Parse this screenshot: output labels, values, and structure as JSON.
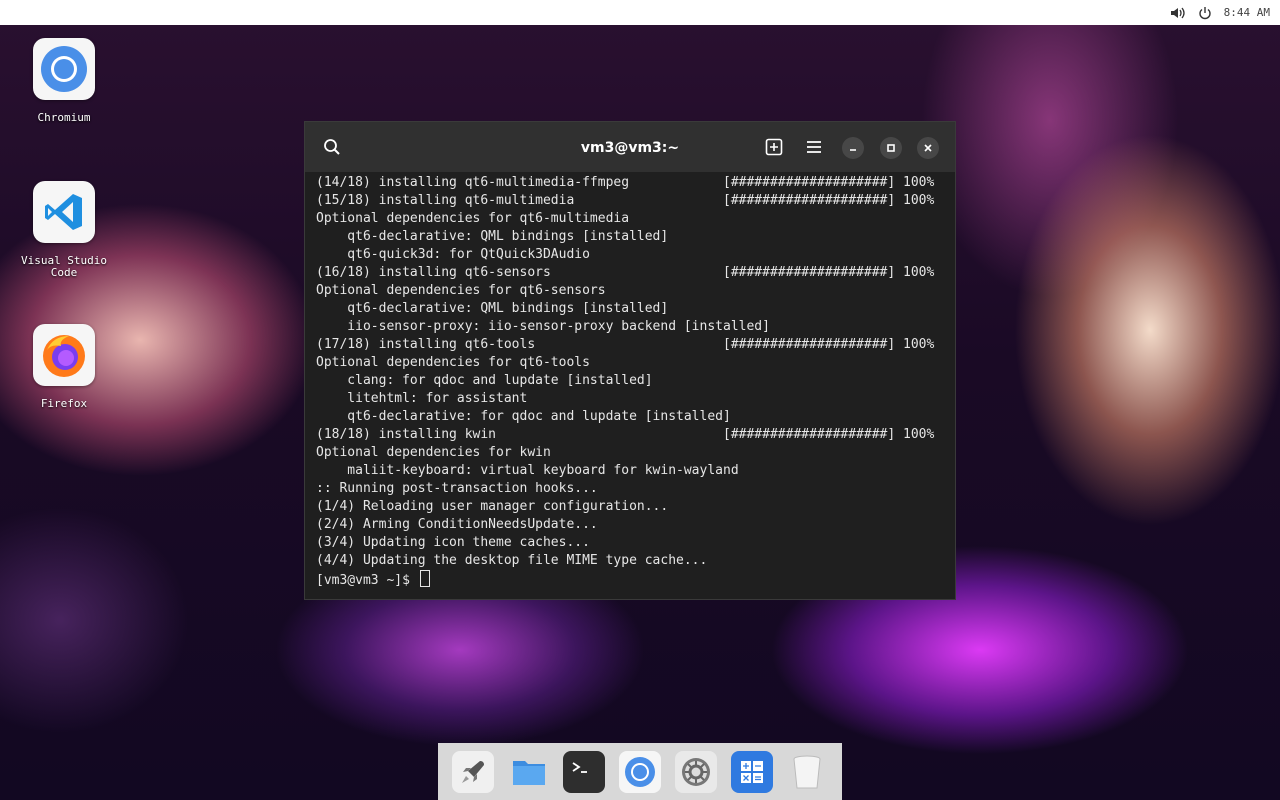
{
  "topbar": {
    "time": "8:44 AM",
    "icons": [
      "volume-icon",
      "power-icon"
    ]
  },
  "desktop": {
    "icons": [
      {
        "label": "Chromium",
        "icon": "chromium-icon"
      },
      {
        "label": "Visual Studio Code",
        "icon": "vscode-icon"
      },
      {
        "label": "Firefox",
        "icon": "firefox-icon"
      }
    ]
  },
  "terminal": {
    "title": "vm3@vm3:~",
    "header_icons": [
      "search-icon",
      "new-tab-icon",
      "menu-icon",
      "minimize-icon",
      "maximize-icon",
      "close-icon"
    ],
    "lines": [
      {
        "text": "(14/18) installing qt6-multimedia-ffmpeg",
        "progress": "[####################] 100%"
      },
      {
        "text": "(15/18) installing qt6-multimedia",
        "progress": "[####################] 100%"
      },
      {
        "text": "Optional dependencies for qt6-multimedia",
        "progress": ""
      },
      {
        "text": "    qt6-declarative: QML bindings [installed]",
        "progress": ""
      },
      {
        "text": "    qt6-quick3d: for QtQuick3DAudio",
        "progress": ""
      },
      {
        "text": "(16/18) installing qt6-sensors",
        "progress": "[####################] 100%"
      },
      {
        "text": "Optional dependencies for qt6-sensors",
        "progress": ""
      },
      {
        "text": "    qt6-declarative: QML bindings [installed]",
        "progress": ""
      },
      {
        "text": "    iio-sensor-proxy: iio-sensor-proxy backend [installed]",
        "progress": ""
      },
      {
        "text": "(17/18) installing qt6-tools",
        "progress": "[####################] 100%"
      },
      {
        "text": "Optional dependencies for qt6-tools",
        "progress": ""
      },
      {
        "text": "    clang: for qdoc and lupdate [installed]",
        "progress": ""
      },
      {
        "text": "    litehtml: for assistant",
        "progress": ""
      },
      {
        "text": "    qt6-declarative: for qdoc and lupdate [installed]",
        "progress": ""
      },
      {
        "text": "(18/18) installing kwin",
        "progress": "[####################] 100%"
      },
      {
        "text": "Optional dependencies for kwin",
        "progress": ""
      },
      {
        "text": "    maliit-keyboard: virtual keyboard for kwin-wayland",
        "progress": ""
      },
      {
        "text": ":: Running post-transaction hooks...",
        "progress": ""
      },
      {
        "text": "(1/4) Reloading user manager configuration...",
        "progress": ""
      },
      {
        "text": "(2/4) Arming ConditionNeedsUpdate...",
        "progress": ""
      },
      {
        "text": "(3/4) Updating icon theme caches...",
        "progress": ""
      },
      {
        "text": "(4/4) Updating the desktop file MIME type cache...",
        "progress": ""
      }
    ],
    "prompt": "[vm3@vm3 ~]$ "
  },
  "dock": {
    "apps": [
      "launcher-icon",
      "files-icon",
      "terminal-icon",
      "chromium-icon",
      "settings-icon",
      "calculator-icon",
      "trash-icon"
    ]
  },
  "colors": {
    "terminal_bg": "#1f1f1f",
    "terminal_header": "#303030",
    "terminal_text": "#e6e6e6",
    "vscode_blue": "#1f8fe0",
    "firefox_orange": "#ff7a1a",
    "chromium_blue": "#4a8fe8"
  }
}
